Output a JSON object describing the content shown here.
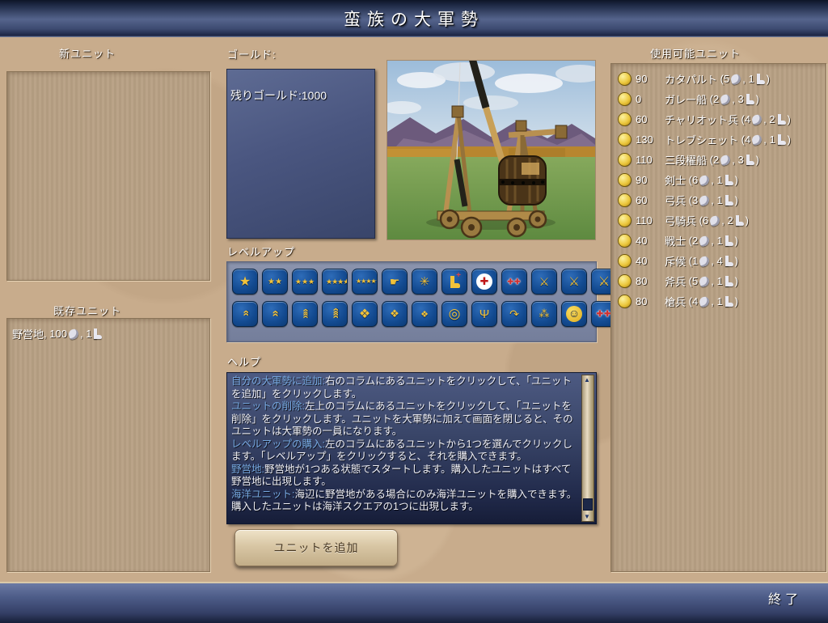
{
  "title": "蛮族の大軍勢",
  "footer": {
    "exit_label": "終了"
  },
  "colors": {
    "title_bar_blue": "#4d5c88",
    "background_tan": "#c8ac8c",
    "panel_tan": "#b7a084",
    "help_heading_blue": "#76a8e0",
    "help_bg_top": "#4d5a82",
    "help_bg_bottom": "#161d38",
    "coin_gold": "#ecc83e",
    "icon_tile_blue": "#134a90",
    "icon_gold": "#f2c23a",
    "button_face": "#d8c6a4"
  },
  "left": {
    "new_units_label": "新ユニット",
    "existing_units_label": "既存ユニット",
    "existing_units": [
      {
        "name": "野営地",
        "strength": "100",
        "moves": "1"
      }
    ]
  },
  "gold": {
    "label": "ゴールド:",
    "remaining_text": "残りゴールド:1000"
  },
  "scene": {
    "description": "trebuchet-render"
  },
  "levelup": {
    "label": "レベルアップ",
    "rows": [
      [
        "combat-1",
        "combat-2",
        "combat-3",
        "combat-4",
        "combat-5",
        "shock-fist",
        "drill-burst",
        "mobility-boot",
        "medic-cross",
        "medic-double-cross",
        "crossed-swords-1",
        "crossed-swords-2",
        "crossed-swords-3"
      ],
      [
        "chevron-rank-1",
        "chevron-rank-2",
        "chevron-rank-3",
        "chevron-rank-4",
        "diamond-formation-1",
        "diamond-formation-2",
        "diamond-formation-3",
        "accuracy-target",
        "leadership-eagle",
        "flanking-arrow",
        "barrage-stars",
        "morale-face",
        "field-medic"
      ]
    ]
  },
  "help": {
    "label": "ヘルプ",
    "entries": [
      {
        "term": "自分の大軍勢に追加:",
        "text": "右のコラムにあるユニットをクリックして、「ユニットを追加」をクリックします。"
      },
      {
        "term": "ユニットの削除:",
        "text": "左上のコラムにあるユニットをクリックして、「ユニットを削除」をクリックします。ユニットを大軍勢に加えて画面を閉じると、そのユニットは大軍勢の一員になります。"
      },
      {
        "term": "レベルアップの購入:",
        "text": "左のコラムにあるユニットから1つを選んでクリックします。「レベルアップ」をクリックすると、それを購入できます。"
      },
      {
        "term": "野営地:",
        "text": "野営地が1つある状態でスタートします。購入したユニットはすべて野営地に出現します。"
      },
      {
        "term": "海洋ユニット:",
        "text": "海辺に野営地がある場合にのみ海洋ユニットを購入できます。購入したユニットは海洋スクエアの1つに出現します。"
      }
    ]
  },
  "add_button_label": "ユニットを追加",
  "available": {
    "label": "使用可能ユニット",
    "format": {
      "open": " (",
      "sep": ", ",
      "close": ")"
    },
    "units": [
      {
        "cost": "90",
        "name": "カタパルト",
        "strength": "5",
        "moves": "1"
      },
      {
        "cost": "0",
        "name": "ガレー船",
        "strength": "2",
        "moves": "3"
      },
      {
        "cost": "60",
        "name": "チャリオット兵",
        "strength": "4",
        "moves": "2"
      },
      {
        "cost": "130",
        "name": "トレブシェット",
        "strength": "4",
        "moves": "1"
      },
      {
        "cost": "110",
        "name": "三段櫂船",
        "strength": "2",
        "moves": "3"
      },
      {
        "cost": "90",
        "name": "剣士",
        "strength": "6",
        "moves": "1"
      },
      {
        "cost": "60",
        "name": "弓兵",
        "strength": "3",
        "moves": "1"
      },
      {
        "cost": "110",
        "name": "弓騎兵",
        "strength": "6",
        "moves": "2"
      },
      {
        "cost": "40",
        "name": "戦士",
        "strength": "2",
        "moves": "1"
      },
      {
        "cost": "40",
        "name": "斥候",
        "strength": "1",
        "moves": "4"
      },
      {
        "cost": "80",
        "name": "斧兵",
        "strength": "5",
        "moves": "1"
      },
      {
        "cost": "80",
        "name": "槍兵",
        "strength": "4",
        "moves": "1"
      }
    ]
  }
}
